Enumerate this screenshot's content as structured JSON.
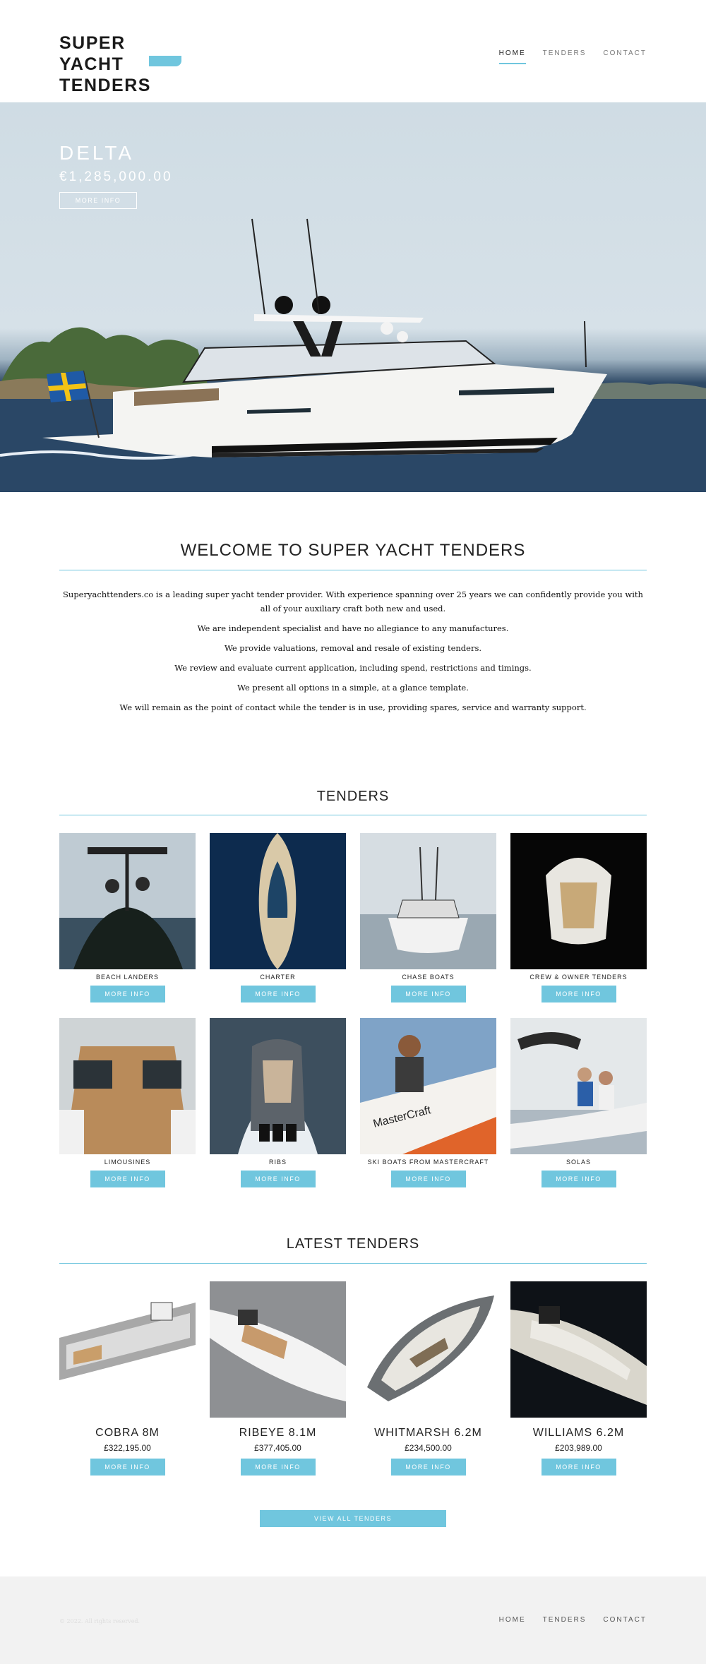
{
  "header": {
    "logo_line1": "SUPER YACHT",
    "logo_line2": "TENDERS",
    "nav": [
      "HOME",
      "TENDERS",
      "CONTACT"
    ]
  },
  "hero": {
    "title": "DELTA",
    "price": "€1,285,000.00",
    "button": "MORE INFO"
  },
  "welcome": {
    "title": "WELCOME TO SUPER YACHT TENDERS",
    "paragraphs": [
      "Superyachttenders.co is a leading super yacht tender provider. With experience spanning over 25 years we can confidently provide you with all of your auxiliary craft both new and used.",
      "We are independent specialist and have no allegiance to any manufactures.",
      "We provide valuations, removal and resale of existing tenders.",
      "We review and evaluate current application, including spend, restrictions and timings.",
      "We present all options in a simple, at a glance template.",
      "We will remain as the point of contact while the tender is in use, providing spares, service and warranty support."
    ]
  },
  "tenders": {
    "title": "TENDERS",
    "button": "MORE INFO",
    "items": [
      "BEACH LANDERS",
      "CHARTER",
      "CHASE BOATS",
      "CREW & OWNER TENDERS",
      "LIMOUSINES",
      "RIBS",
      "SKI BOATS FROM MASTERCRAFT",
      "SOLAS"
    ]
  },
  "latest": {
    "title": "LATEST TENDERS",
    "button": "MORE INFO",
    "view_all": "VIEW ALL TENDERS",
    "items": [
      {
        "name": "COBRA 8M",
        "price": "£322,195.00"
      },
      {
        "name": "RIBEYE 8.1M",
        "price": "£377,405.00"
      },
      {
        "name": "WHITMARSH 6.2M",
        "price": "£234,500.00"
      },
      {
        "name": "WILLIAMS 6.2M",
        "price": "£203,989.00"
      }
    ]
  },
  "footer": {
    "copyright": "© 2022. All rights reserved.",
    "nav": [
      "HOME",
      "TENDERS",
      "CONTACT"
    ]
  },
  "colors": {
    "accent": "#70c6de",
    "footer_bg": "#f2f2f2"
  }
}
